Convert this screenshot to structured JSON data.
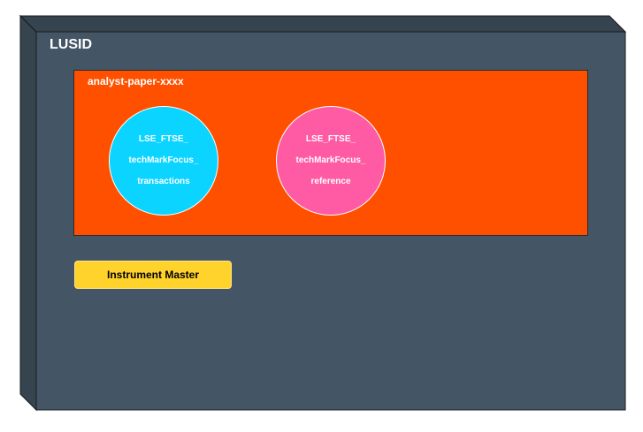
{
  "node": {
    "title": "LUSID",
    "color": "#445566"
  },
  "environment": {
    "title": "analyst-paper-xxxx",
    "color": "#ff5000"
  },
  "circles": [
    {
      "lines": [
        "LSE_FTSE_",
        "techMarkFocus_",
        "transactions"
      ],
      "color": "#0ad4ff"
    },
    {
      "lines": [
        "LSE_FTSE_",
        "techMarkFocus_",
        "reference"
      ],
      "color": "#ff5ba4"
    }
  ],
  "master": {
    "label": "Instrument Master",
    "color": "#ffd22c"
  }
}
